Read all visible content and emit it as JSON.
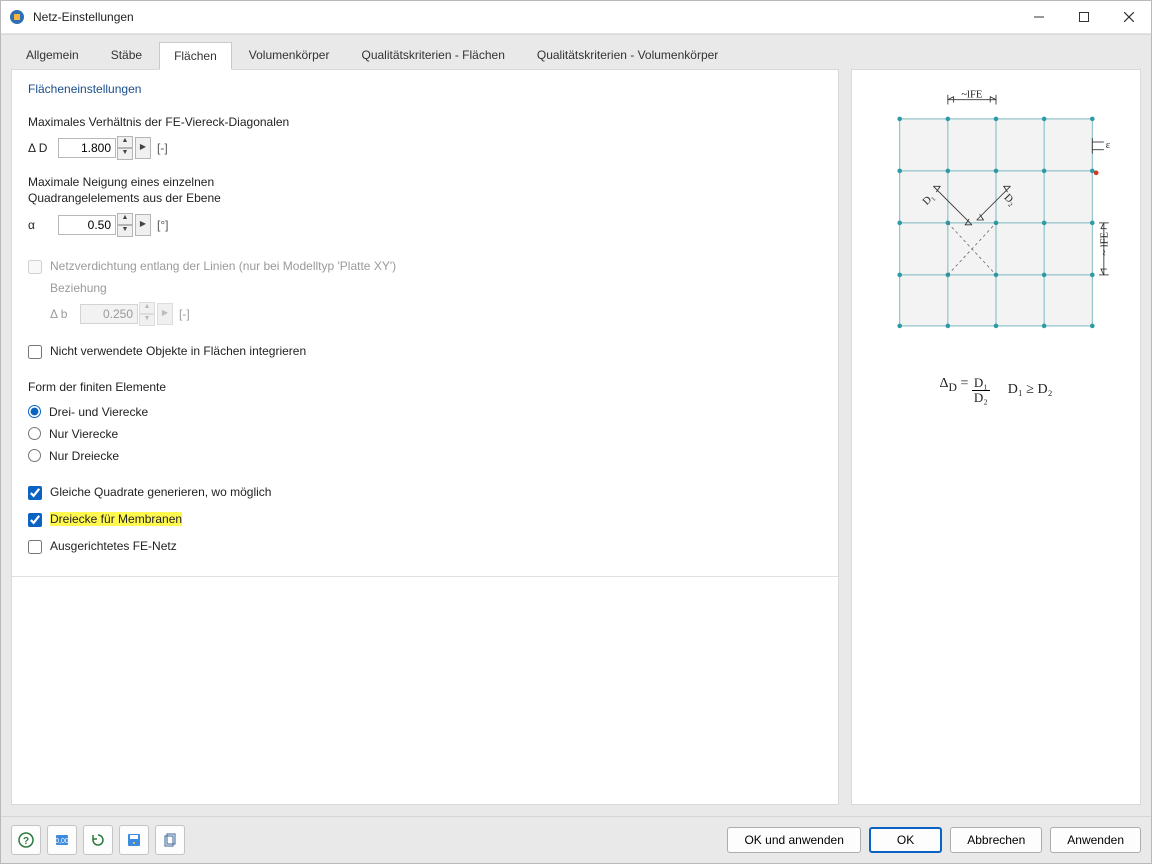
{
  "window": {
    "title": "Netz-Einstellungen"
  },
  "tabs": [
    {
      "label": "Allgemein"
    },
    {
      "label": "Stäbe"
    },
    {
      "label": "Flächen",
      "active": true
    },
    {
      "label": "Volumenkörper"
    },
    {
      "label": "Qualitätskriterien - Flächen"
    },
    {
      "label": "Qualitätskriterien - Volumenkörper"
    }
  ],
  "sections": {
    "surface_settings_head": "Flächeneinstellungen",
    "max_diag_ratio_label": "Maximales Verhältnis der FE-Viereck-Diagonalen",
    "max_diag_ratio": {
      "symbol": "Δ D",
      "value": "1.800",
      "unit": "[-]"
    },
    "max_incline_label_l1": "Maximale Neigung eines einzelnen",
    "max_incline_label_l2": "Quadrangelelements aus der Ebene",
    "max_incline": {
      "symbol": "α",
      "value": "0.50",
      "unit": "[°]"
    },
    "densify": {
      "label": "Netzverdichtung entlang der Linien (nur bei Modelltyp 'Platte XY')",
      "relation_label": "Beziehung",
      "relation": {
        "symbol": "Δ b",
        "value": "0.250",
        "unit": "[-]"
      }
    },
    "integrate_unused_label": "Nicht verwendete Objekte in Flächen integrieren",
    "shape_head": "Form der finiten Elemente",
    "shape_opts": {
      "both": "Drei- und Vierecke",
      "quads": "Nur Vierecke",
      "tris": "Nur Dreiecke"
    },
    "gen_equal_squares": "Gleiche Quadrate generieren, wo möglich",
    "tri_membranes": "Dreiecke für Membranen",
    "aligned_mesh": "Ausgerichtetes FE-Netz"
  },
  "buttons": {
    "ok_apply": "OK und anwenden",
    "ok": "OK",
    "cancel": "Abbrechen",
    "apply": "Anwenden"
  },
  "diagram": {
    "d1": "D₁",
    "d2": "D₂",
    "lfe": "~ lFE",
    "lfe_top": "~lFE",
    "eps": "ε",
    "formula_lhs": "Δ",
    "formula_sub": "D",
    "frac_top": "D₁",
    "frac_bot": "D₂",
    "cond": "D₁ ≥ D₂"
  }
}
